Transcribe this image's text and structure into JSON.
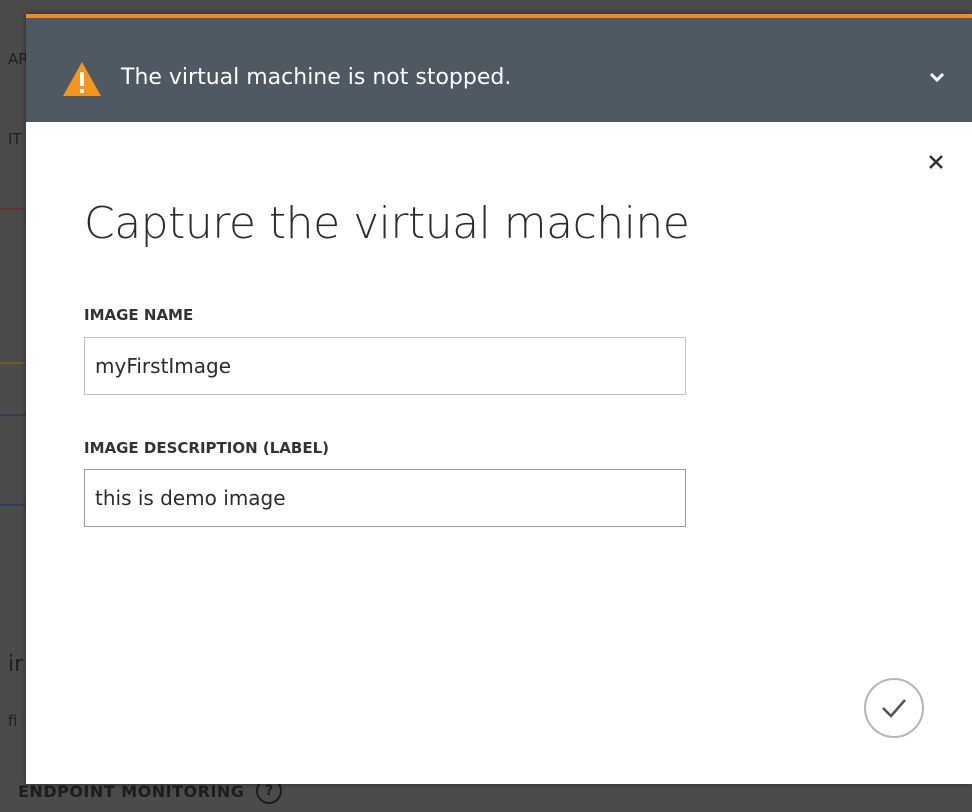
{
  "warning": {
    "message": "The virtual machine is not stopped.",
    "accent_color": "#f58a1f",
    "bar_color": "#4f5963",
    "icon": "warning-triangle-icon"
  },
  "dialog": {
    "title": "Capture the virtual machine",
    "close_icon": "close-icon",
    "expand_icon": "chevron-down-icon"
  },
  "form": {
    "image_name": {
      "label": "IMAGE NAME",
      "value": "myFirstImage"
    },
    "image_description": {
      "label": "IMAGE DESCRIPTION (LABEL)",
      "value": "this is demo image"
    }
  },
  "actions": {
    "confirm_icon": "checkmark-icon"
  },
  "background": {
    "fragments": [
      "AR",
      "IT",
      "ir",
      "fi"
    ],
    "footer_label": "ENDPOINT MONITORING",
    "footer_icon": "?"
  }
}
